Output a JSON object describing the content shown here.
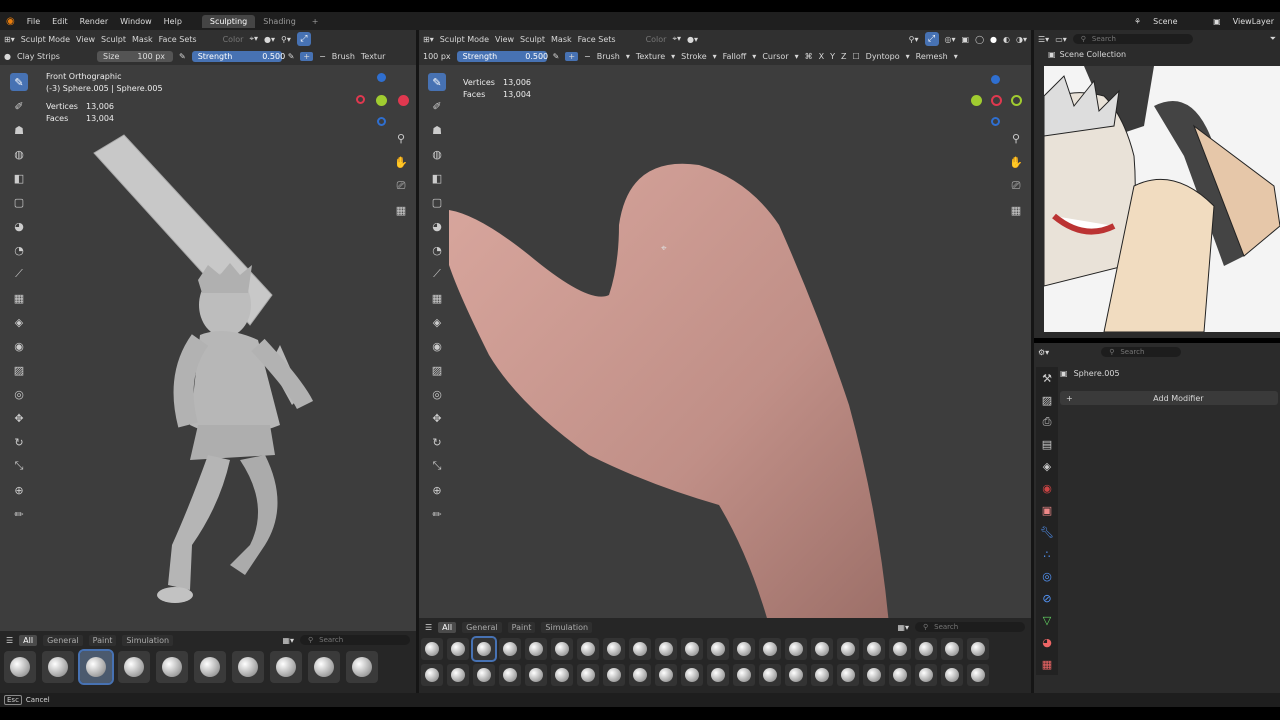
{
  "menu": {
    "items": [
      "File",
      "Edit",
      "Render",
      "Window",
      "Help"
    ],
    "workspaces": [
      "Sculpting",
      "Shading"
    ],
    "active_workspace": "Sculpting",
    "add_workspace": "+",
    "scene_label": "Scene",
    "view_layer_label": "ViewLayer"
  },
  "left_viewport": {
    "mode": "Sculpt Mode",
    "menus": [
      "View",
      "Sculpt",
      "Mask",
      "Face Sets"
    ],
    "color_label": "Color",
    "brush_name": "Clay Strips",
    "size_label": "Size",
    "size_value": "100 px",
    "strength_label": "Strength",
    "strength_value": "0.500",
    "brush_menu": "Brush",
    "texture_menu": "Textur",
    "view_name": "Front Orthographic",
    "object_name": "(-3) Sphere.005 | Sphere.005",
    "vertices_label": "Vertices",
    "vertices_value": "13,006",
    "faces_label": "Faces",
    "faces_value": "13,004"
  },
  "right_viewport": {
    "mode": "Sculpt Mode",
    "menus": [
      "View",
      "Sculpt",
      "Mask",
      "Face Sets"
    ],
    "color_label": "Color",
    "size_value": "100 px",
    "strength_label": "Strength",
    "strength_value": "0.500",
    "tool_menus": [
      "Brush",
      "Texture",
      "Stroke",
      "Falloff",
      "Cursor"
    ],
    "axes": [
      "X",
      "Y",
      "Z"
    ],
    "dyntopo": "Dyntopo",
    "remesh": "Remesh",
    "vertices_label": "Vertices",
    "vertices_value": "13,006",
    "faces_label": "Faces",
    "faces_value": "13,004"
  },
  "shelf": {
    "tabs": [
      "All",
      "General",
      "Paint",
      "Simulation"
    ],
    "search_placeholder": "Search"
  },
  "outliner": {
    "search_placeholder": "Search",
    "collection": "Scene Collection"
  },
  "properties": {
    "search_placeholder": "Search",
    "object": "Sphere.005",
    "add_modifier": "Add Modifier"
  },
  "status": {
    "key": "Esc",
    "action": "Cancel"
  },
  "colors": {
    "accent": "#4772b3",
    "viewport": "#3d3d3d",
    "skin": "#c08f87"
  }
}
